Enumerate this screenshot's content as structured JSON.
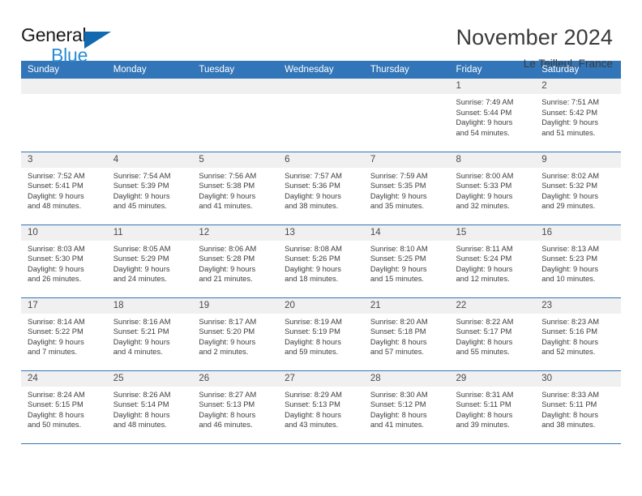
{
  "logo": {
    "word1": "General",
    "word2": "Blue",
    "triangle_color": "#1269b0",
    "word2_color": "#2a8cd4"
  },
  "header": {
    "title": "November 2024",
    "subtitle": "Le Teilleul, France"
  },
  "theme": {
    "header_row_bg": "#3275b8",
    "daynum_bg": "#f0f0f0",
    "row_divider": "#3275b8",
    "text": "#3d3d3d"
  },
  "weekdays": [
    "Sunday",
    "Monday",
    "Tuesday",
    "Wednesday",
    "Thursday",
    "Friday",
    "Saturday"
  ],
  "labels": {
    "sunrise": "Sunrise:",
    "sunset": "Sunset:",
    "daylight": "Daylight:"
  },
  "weeks": [
    [
      {
        "day": "",
        "sunrise": "",
        "sunset": "",
        "daylight1": "",
        "daylight2": "",
        "empty": true
      },
      {
        "day": "",
        "sunrise": "",
        "sunset": "",
        "daylight1": "",
        "daylight2": "",
        "empty": true
      },
      {
        "day": "",
        "sunrise": "",
        "sunset": "",
        "daylight1": "",
        "daylight2": "",
        "empty": true
      },
      {
        "day": "",
        "sunrise": "",
        "sunset": "",
        "daylight1": "",
        "daylight2": "",
        "empty": true
      },
      {
        "day": "",
        "sunrise": "",
        "sunset": "",
        "daylight1": "",
        "daylight2": "",
        "empty": true
      },
      {
        "day": "1",
        "sunrise": "Sunrise: 7:49 AM",
        "sunset": "Sunset: 5:44 PM",
        "daylight1": "Daylight: 9 hours",
        "daylight2": "and 54 minutes.",
        "empty": false
      },
      {
        "day": "2",
        "sunrise": "Sunrise: 7:51 AM",
        "sunset": "Sunset: 5:42 PM",
        "daylight1": "Daylight: 9 hours",
        "daylight2": "and 51 minutes.",
        "empty": false
      }
    ],
    [
      {
        "day": "3",
        "sunrise": "Sunrise: 7:52 AM",
        "sunset": "Sunset: 5:41 PM",
        "daylight1": "Daylight: 9 hours",
        "daylight2": "and 48 minutes.",
        "empty": false
      },
      {
        "day": "4",
        "sunrise": "Sunrise: 7:54 AM",
        "sunset": "Sunset: 5:39 PM",
        "daylight1": "Daylight: 9 hours",
        "daylight2": "and 45 minutes.",
        "empty": false
      },
      {
        "day": "5",
        "sunrise": "Sunrise: 7:56 AM",
        "sunset": "Sunset: 5:38 PM",
        "daylight1": "Daylight: 9 hours",
        "daylight2": "and 41 minutes.",
        "empty": false
      },
      {
        "day": "6",
        "sunrise": "Sunrise: 7:57 AM",
        "sunset": "Sunset: 5:36 PM",
        "daylight1": "Daylight: 9 hours",
        "daylight2": "and 38 minutes.",
        "empty": false
      },
      {
        "day": "7",
        "sunrise": "Sunrise: 7:59 AM",
        "sunset": "Sunset: 5:35 PM",
        "daylight1": "Daylight: 9 hours",
        "daylight2": "and 35 minutes.",
        "empty": false
      },
      {
        "day": "8",
        "sunrise": "Sunrise: 8:00 AM",
        "sunset": "Sunset: 5:33 PM",
        "daylight1": "Daylight: 9 hours",
        "daylight2": "and 32 minutes.",
        "empty": false
      },
      {
        "day": "9",
        "sunrise": "Sunrise: 8:02 AM",
        "sunset": "Sunset: 5:32 PM",
        "daylight1": "Daylight: 9 hours",
        "daylight2": "and 29 minutes.",
        "empty": false
      }
    ],
    [
      {
        "day": "10",
        "sunrise": "Sunrise: 8:03 AM",
        "sunset": "Sunset: 5:30 PM",
        "daylight1": "Daylight: 9 hours",
        "daylight2": "and 26 minutes.",
        "empty": false
      },
      {
        "day": "11",
        "sunrise": "Sunrise: 8:05 AM",
        "sunset": "Sunset: 5:29 PM",
        "daylight1": "Daylight: 9 hours",
        "daylight2": "and 24 minutes.",
        "empty": false
      },
      {
        "day": "12",
        "sunrise": "Sunrise: 8:06 AM",
        "sunset": "Sunset: 5:28 PM",
        "daylight1": "Daylight: 9 hours",
        "daylight2": "and 21 minutes.",
        "empty": false
      },
      {
        "day": "13",
        "sunrise": "Sunrise: 8:08 AM",
        "sunset": "Sunset: 5:26 PM",
        "daylight1": "Daylight: 9 hours",
        "daylight2": "and 18 minutes.",
        "empty": false
      },
      {
        "day": "14",
        "sunrise": "Sunrise: 8:10 AM",
        "sunset": "Sunset: 5:25 PM",
        "daylight1": "Daylight: 9 hours",
        "daylight2": "and 15 minutes.",
        "empty": false
      },
      {
        "day": "15",
        "sunrise": "Sunrise: 8:11 AM",
        "sunset": "Sunset: 5:24 PM",
        "daylight1": "Daylight: 9 hours",
        "daylight2": "and 12 minutes.",
        "empty": false
      },
      {
        "day": "16",
        "sunrise": "Sunrise: 8:13 AM",
        "sunset": "Sunset: 5:23 PM",
        "daylight1": "Daylight: 9 hours",
        "daylight2": "and 10 minutes.",
        "empty": false
      }
    ],
    [
      {
        "day": "17",
        "sunrise": "Sunrise: 8:14 AM",
        "sunset": "Sunset: 5:22 PM",
        "daylight1": "Daylight: 9 hours",
        "daylight2": "and 7 minutes.",
        "empty": false
      },
      {
        "day": "18",
        "sunrise": "Sunrise: 8:16 AM",
        "sunset": "Sunset: 5:21 PM",
        "daylight1": "Daylight: 9 hours",
        "daylight2": "and 4 minutes.",
        "empty": false
      },
      {
        "day": "19",
        "sunrise": "Sunrise: 8:17 AM",
        "sunset": "Sunset: 5:20 PM",
        "daylight1": "Daylight: 9 hours",
        "daylight2": "and 2 minutes.",
        "empty": false
      },
      {
        "day": "20",
        "sunrise": "Sunrise: 8:19 AM",
        "sunset": "Sunset: 5:19 PM",
        "daylight1": "Daylight: 8 hours",
        "daylight2": "and 59 minutes.",
        "empty": false
      },
      {
        "day": "21",
        "sunrise": "Sunrise: 8:20 AM",
        "sunset": "Sunset: 5:18 PM",
        "daylight1": "Daylight: 8 hours",
        "daylight2": "and 57 minutes.",
        "empty": false
      },
      {
        "day": "22",
        "sunrise": "Sunrise: 8:22 AM",
        "sunset": "Sunset: 5:17 PM",
        "daylight1": "Daylight: 8 hours",
        "daylight2": "and 55 minutes.",
        "empty": false
      },
      {
        "day": "23",
        "sunrise": "Sunrise: 8:23 AM",
        "sunset": "Sunset: 5:16 PM",
        "daylight1": "Daylight: 8 hours",
        "daylight2": "and 52 minutes.",
        "empty": false
      }
    ],
    [
      {
        "day": "24",
        "sunrise": "Sunrise: 8:24 AM",
        "sunset": "Sunset: 5:15 PM",
        "daylight1": "Daylight: 8 hours",
        "daylight2": "and 50 minutes.",
        "empty": false
      },
      {
        "day": "25",
        "sunrise": "Sunrise: 8:26 AM",
        "sunset": "Sunset: 5:14 PM",
        "daylight1": "Daylight: 8 hours",
        "daylight2": "and 48 minutes.",
        "empty": false
      },
      {
        "day": "26",
        "sunrise": "Sunrise: 8:27 AM",
        "sunset": "Sunset: 5:13 PM",
        "daylight1": "Daylight: 8 hours",
        "daylight2": "and 46 minutes.",
        "empty": false
      },
      {
        "day": "27",
        "sunrise": "Sunrise: 8:29 AM",
        "sunset": "Sunset: 5:13 PM",
        "daylight1": "Daylight: 8 hours",
        "daylight2": "and 43 minutes.",
        "empty": false
      },
      {
        "day": "28",
        "sunrise": "Sunrise: 8:30 AM",
        "sunset": "Sunset: 5:12 PM",
        "daylight1": "Daylight: 8 hours",
        "daylight2": "and 41 minutes.",
        "empty": false
      },
      {
        "day": "29",
        "sunrise": "Sunrise: 8:31 AM",
        "sunset": "Sunset: 5:11 PM",
        "daylight1": "Daylight: 8 hours",
        "daylight2": "and 39 minutes.",
        "empty": false
      },
      {
        "day": "30",
        "sunrise": "Sunrise: 8:33 AM",
        "sunset": "Sunset: 5:11 PM",
        "daylight1": "Daylight: 8 hours",
        "daylight2": "and 38 minutes.",
        "empty": false
      }
    ]
  ]
}
